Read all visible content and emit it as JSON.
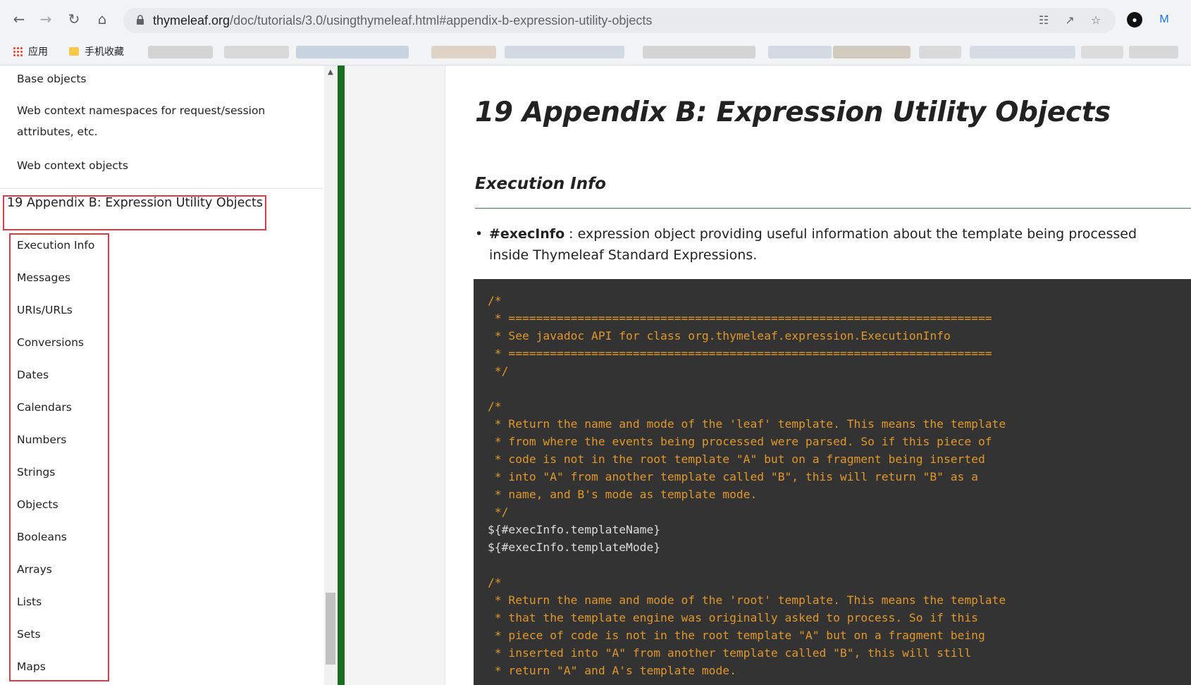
{
  "browser": {
    "url_host": "thymeleaf.org",
    "url_path": "/doc/tutorials/3.0/usingthymeleaf.html#appendix-b-expression-utility-objects",
    "bookmarks": [
      "应用",
      "手机收藏"
    ]
  },
  "sidebar": {
    "prev_items": [
      "Base objects",
      "Web context namespaces for request/session attributes, etc.",
      "Web context objects"
    ],
    "chapter": "19 Appendix B: Expression Utility Objects",
    "subitems": [
      "Execution Info",
      "Messages",
      "URIs/URLs",
      "Conversions",
      "Dates",
      "Calendars",
      "Numbers",
      "Strings",
      "Objects",
      "Booleans",
      "Arrays",
      "Lists",
      "Sets",
      "Maps"
    ]
  },
  "content": {
    "title": "19 Appendix B: Expression Utility Objects",
    "section": "Execution Info",
    "bullet_term": "#execInfo",
    "bullet_text": " : expression object providing useful information about the template being processed inside Thymeleaf Standard Expressions.",
    "code_lines": [
      {
        "t": "/*",
        "c": true
      },
      {
        "t": " * ======================================================================",
        "c": true
      },
      {
        "t": " * See javadoc API for class org.thymeleaf.expression.ExecutionInfo",
        "c": true
      },
      {
        "t": " * ======================================================================",
        "c": true
      },
      {
        "t": " */",
        "c": true
      },
      {
        "t": "",
        "c": false
      },
      {
        "t": "/*",
        "c": true
      },
      {
        "t": " * Return the name and mode of the 'leaf' template. This means the template",
        "c": true
      },
      {
        "t": " * from where the events being processed were parsed. So if this piece of",
        "c": true
      },
      {
        "t": " * code is not in the root template \"A\" but on a fragment being inserted",
        "c": true
      },
      {
        "t": " * into \"A\" from another template called \"B\", this will return \"B\" as a",
        "c": true
      },
      {
        "t": " * name, and B's mode as template mode.",
        "c": true
      },
      {
        "t": " */",
        "c": true
      },
      {
        "t": "${#execInfo.templateName}",
        "c": false
      },
      {
        "t": "${#execInfo.templateMode}",
        "c": false
      },
      {
        "t": "",
        "c": false
      },
      {
        "t": "/*",
        "c": true
      },
      {
        "t": " * Return the name and mode of the 'root' template. This means the template",
        "c": true
      },
      {
        "t": " * that the template engine was originally asked to process. So if this",
        "c": true
      },
      {
        "t": " * piece of code is not in the root template \"A\" but on a fragment being",
        "c": true
      },
      {
        "t": " * inserted into \"A\" from another template called \"B\", this will still",
        "c": true
      },
      {
        "t": " * return \"A\" and A's template mode.",
        "c": true
      }
    ]
  },
  "colors": {
    "highlight_box": "#e03a44",
    "accent_green": "#16701e",
    "code_bg": "#333333",
    "comment": "#e0972b"
  }
}
